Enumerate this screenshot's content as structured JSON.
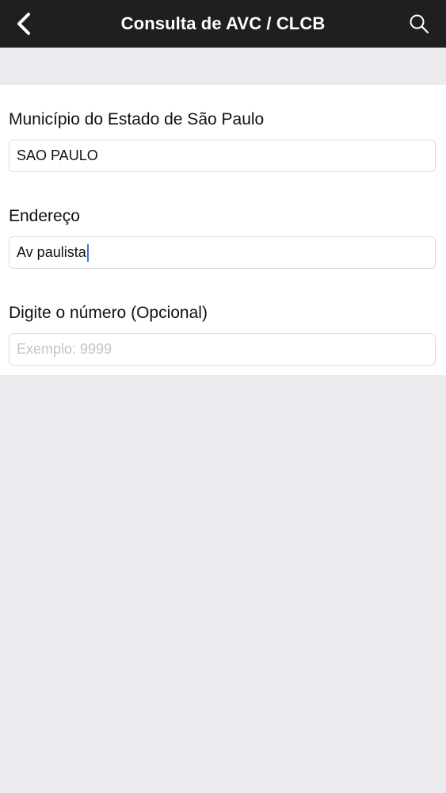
{
  "nav": {
    "title": "Consulta de AVC / CLCB",
    "back_icon": "chevron-left-icon",
    "search_icon": "search-icon",
    "background_color": "#1f1f1f"
  },
  "form": {
    "municipio": {
      "label": "Município do Estado de São Paulo",
      "value": "SAO PAULO"
    },
    "endereco": {
      "label": "Endereço",
      "value": "Av paulista"
    },
    "numero": {
      "label": "Digite o número (Opcional)",
      "value": "",
      "placeholder": "Exemplo: 9999"
    }
  },
  "colors": {
    "caret": "#3d6fe0",
    "page_background": "#ebeaee"
  }
}
